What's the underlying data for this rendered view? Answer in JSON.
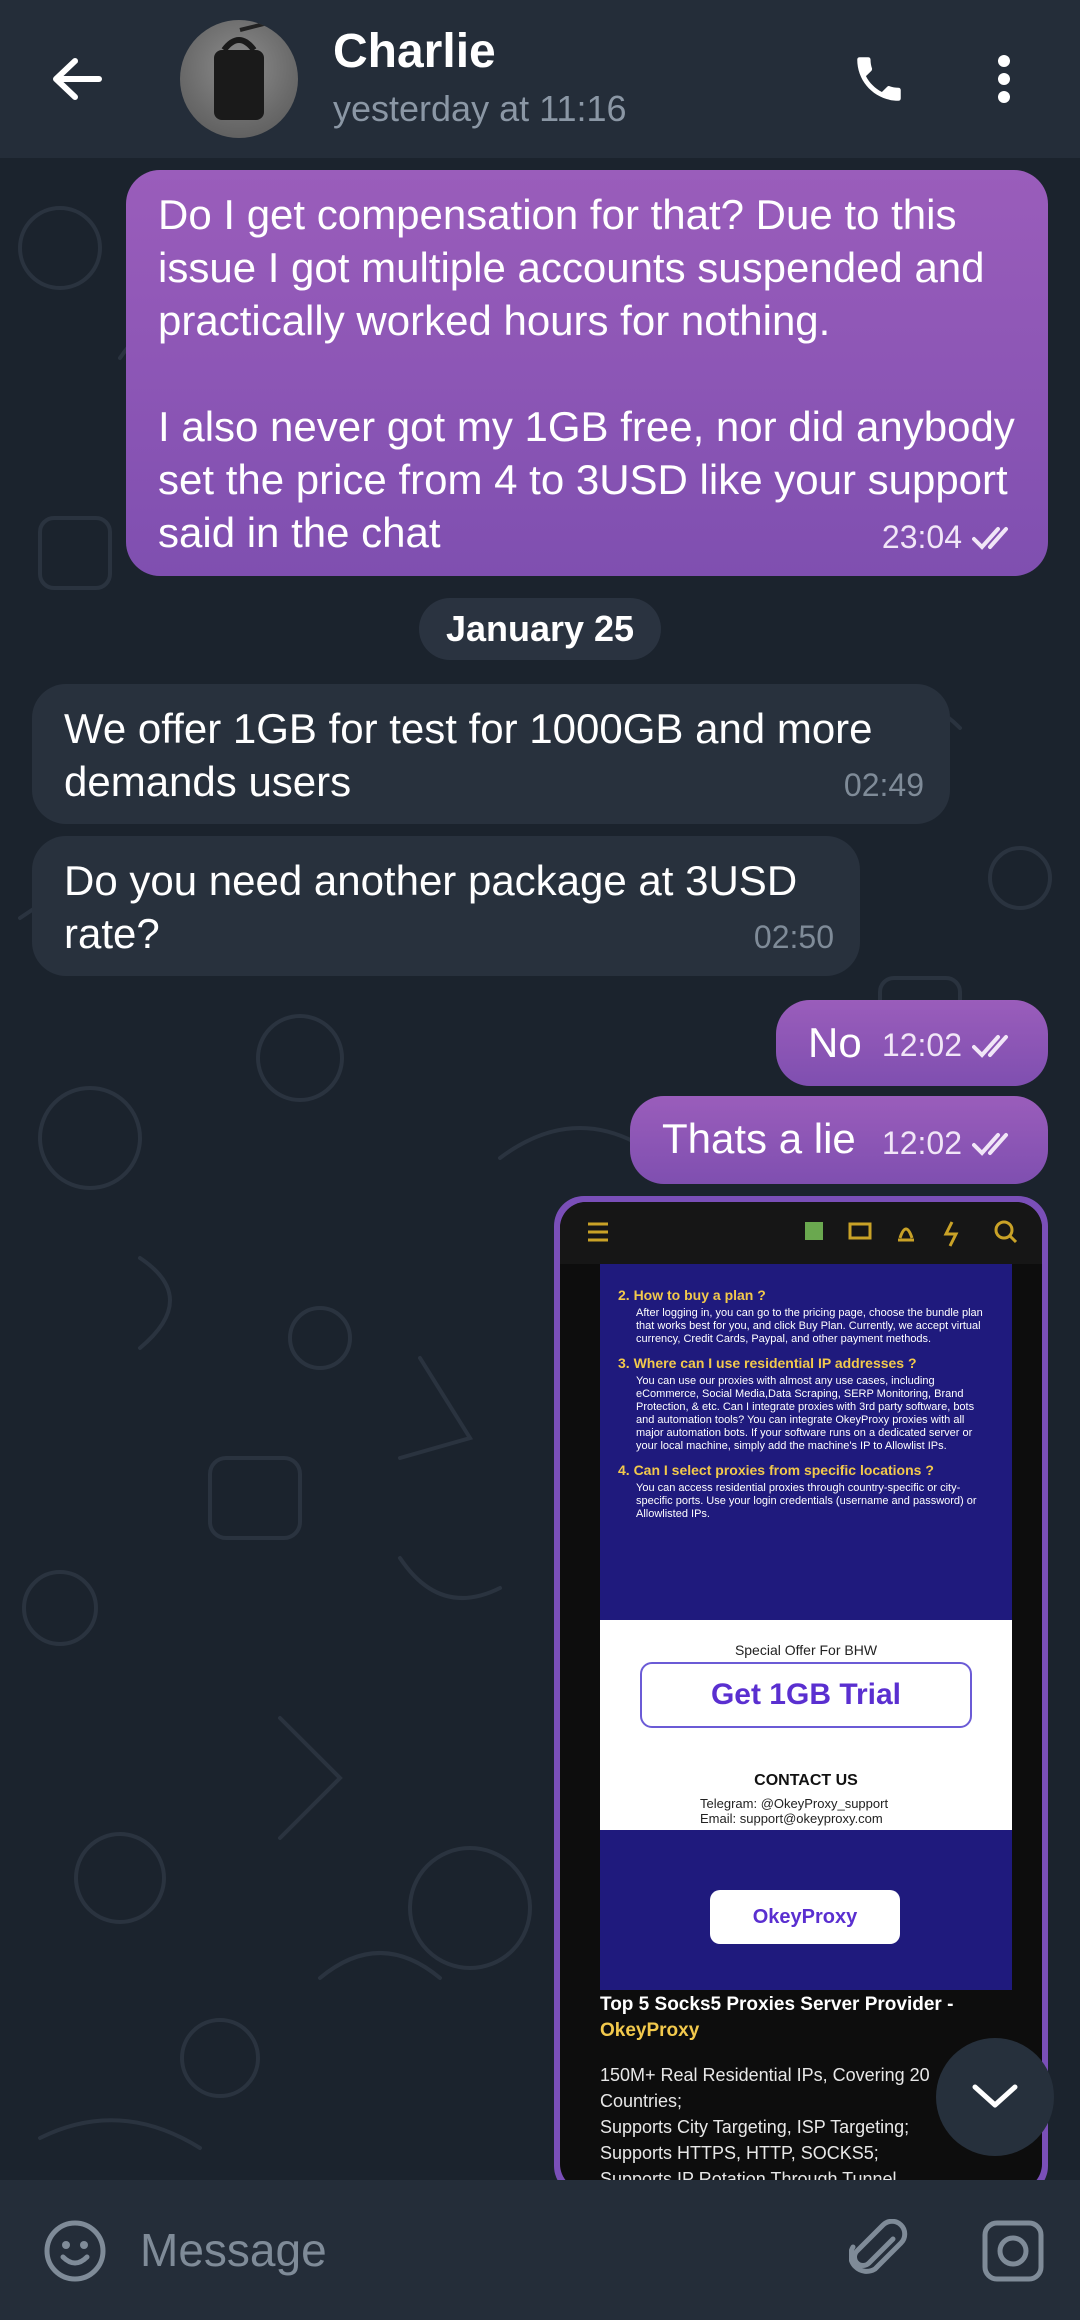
{
  "header": {
    "name": "Charlie",
    "status": "yesterday at 11:16"
  },
  "messages": [
    {
      "direction": "out",
      "text": "Do I get compensation for that? Due to this issue I got multiple accounts suspended and practically worked hours for nothing.\n\nI also never got my 1GB free, nor did anybody set the price from 4 to 3USD like your support said in the chat",
      "time": "23:04",
      "read": true
    },
    {
      "direction": "in",
      "text": "We offer 1GB for test for 1000GB and more demands users",
      "time": "02:49"
    },
    {
      "direction": "in",
      "text": "Do you need another package at 3USD rate?",
      "time": "02:50"
    },
    {
      "direction": "out",
      "text": "No",
      "time": "12:02",
      "read": true
    },
    {
      "direction": "out",
      "text": "Thats a lie",
      "time": "12:02",
      "read": true
    }
  ],
  "date_separator": "January 25",
  "image_message": {
    "faq": [
      {
        "q": "2. How to buy a plan ?",
        "a": "After logging in, you can go to the pricing page, choose the bundle plan that works best for you, and click Buy Plan. Currently, we accept virtual currency, Credit Cards, Paypal, and other payment methods."
      },
      {
        "q": "3. Where can I use residential IP addresses ?",
        "a": "You can use our proxies with almost any use cases, including eCommerce, Social Media,Data Scraping, SERP Monitoring, Brand Protection, & etc. Can I integrate proxies with 3rd party software, bots and automation tools? You can integrate OkeyProxy proxies with all major automation bots. If your software runs on a dedicated server or your local machine, simply add the machine's IP to Allowlist IPs."
      },
      {
        "q": "4. Can I select proxies from specific locations ?",
        "a": "You can access residential proxies through country-specific or city-specific ports. Use your login credentials (username and password) or Allowlisted IPs."
      }
    ],
    "special_offer": "Special Offer For BHW",
    "trial_label": "Get 1GB  Trial",
    "contact_heading": "CONTACT US",
    "telegram": "Telegram: @OkeyProxy_support",
    "email": "Email: support@okeyproxy.com",
    "logo_text": "OkeyProxy",
    "title_main": "Top 5 Socks5 Proxies Server Provider - ",
    "title_brand": "OkeyProxy",
    "body_lines": [
      "150M+ Real Residential IPs, Covering 20",
      "Countries;",
      "Supports City Targeting, ISP Targeting;",
      "Supports HTTPS, HTTP, SOCKS5;",
      "Supports IP Rotation Through Tunnel..."
    ]
  },
  "input": {
    "placeholder": "Message"
  },
  "colors": {
    "outgoing_bubble": "#8a55b5",
    "incoming_bubble": "#28313d",
    "header_bg": "#242d39",
    "chat_bg": "#1b232d"
  },
  "icons": [
    "back-arrow-icon",
    "phone-icon",
    "more-vertical-icon",
    "double-check-icon",
    "chevron-down-icon",
    "emoji-icon",
    "paperclip-icon",
    "camera-icon"
  ]
}
